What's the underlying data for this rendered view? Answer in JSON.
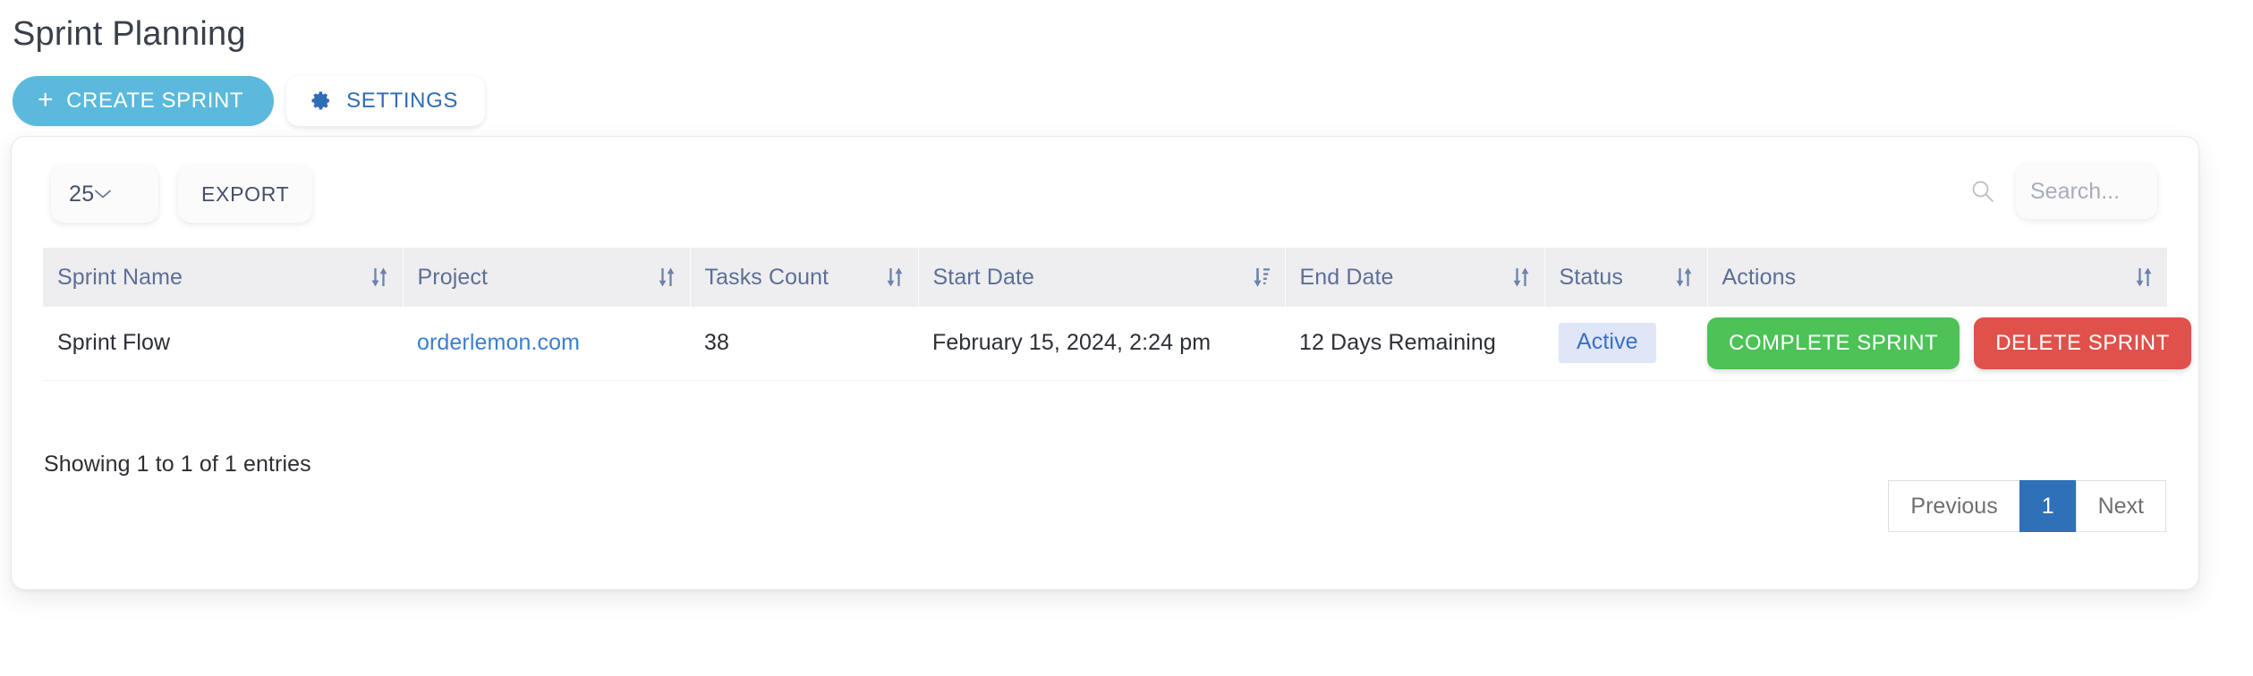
{
  "page": {
    "title": "Sprint Planning"
  },
  "toolbar": {
    "create_label": "CREATE SPRINT",
    "create_plus": "+",
    "create_color": "#5bb9dd",
    "settings_label": "SETTINGS",
    "settings_icon": "gear-icon",
    "settings_color": "#2f6db5"
  },
  "controls": {
    "page_length_value": "25",
    "page_length_options": [
      "25"
    ],
    "export_label": "EXPORT",
    "search_placeholder": "Search...",
    "search_value": "",
    "search_icon": "search-icon"
  },
  "table": {
    "columns": [
      {
        "label": "Sprint Name",
        "sort": "none"
      },
      {
        "label": "Project",
        "sort": "none"
      },
      {
        "label": "Tasks Count",
        "sort": "none"
      },
      {
        "label": "Start Date",
        "sort": "desc"
      },
      {
        "label": "End Date",
        "sort": "none"
      },
      {
        "label": "Status",
        "sort": "none"
      },
      {
        "label": "Actions",
        "sort": "none"
      }
    ],
    "rows": [
      {
        "sprint_name": "Sprint Flow",
        "project": "orderlemon.com",
        "tasks_count": "38",
        "start_date": "February 15, 2024, 2:24 pm",
        "end_date": "12 Days Remaining",
        "status": "Active",
        "status_bg": "#dfe6f7",
        "status_fg": "#3a70c4",
        "complete_label": "COMPLETE SPRINT",
        "complete_color": "#4cc257",
        "delete_label": "DELETE SPRINT",
        "delete_color": "#e0514b"
      }
    ]
  },
  "footer": {
    "info": "Showing 1 to 1 of 1 entries",
    "previous_label": "Previous",
    "page_1_label": "1",
    "next_label": "Next",
    "active_page_color": "#2e71b8"
  }
}
